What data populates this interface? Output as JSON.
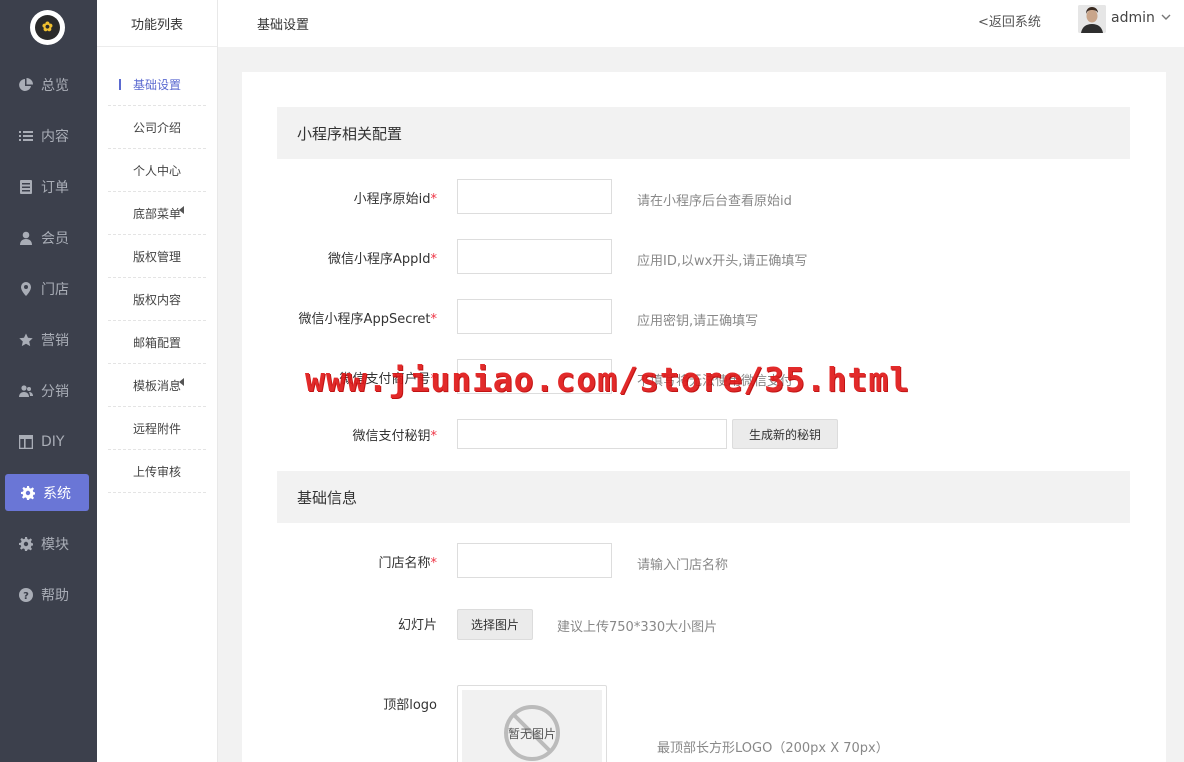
{
  "sidebar": {
    "items": [
      {
        "label": "总览",
        "icon": "pie-chart-icon"
      },
      {
        "label": "内容",
        "icon": "list-icon"
      },
      {
        "label": "订单",
        "icon": "document-icon"
      },
      {
        "label": "会员",
        "icon": "user-icon"
      },
      {
        "label": "门店",
        "icon": "location-pin-icon"
      },
      {
        "label": "营销",
        "icon": "star-icon"
      },
      {
        "label": "分销",
        "icon": "users-icon"
      },
      {
        "label": "DIY",
        "icon": "layout-icon"
      },
      {
        "label": "系统",
        "icon": "gear-icon"
      },
      {
        "label": "模块",
        "icon": "gear-icon"
      },
      {
        "label": "帮助",
        "icon": "help-icon"
      }
    ],
    "active": "系统"
  },
  "subpanel": {
    "title": "功能列表",
    "items": [
      {
        "label": "基础设置"
      },
      {
        "label": "公司介绍"
      },
      {
        "label": "个人中心"
      },
      {
        "label": "底部菜单"
      },
      {
        "label": "版权管理"
      },
      {
        "label": "版权内容"
      },
      {
        "label": "邮箱配置"
      },
      {
        "label": "模板消息"
      },
      {
        "label": "远程附件"
      },
      {
        "label": "上传审核"
      }
    ]
  },
  "topbar": {
    "breadcrumb": "基础设置",
    "back_label": "<返回系统",
    "username": "admin"
  },
  "form": {
    "section1_title": "小程序相关配置",
    "rows1": [
      {
        "label": "小程序原始id",
        "hint": "请在小程序后台查看原始id"
      },
      {
        "label": "微信小程序AppId",
        "hint": "应用ID,以wx开头,请正确填写"
      },
      {
        "label": "微信小程序AppSecret",
        "hint": "应用密钥,请正确填写"
      },
      {
        "label": "微信支付商户号",
        "hint": "不填写将无法使用微信支付"
      },
      {
        "label": "微信支付秘钥",
        "hint": ""
      }
    ],
    "generate_key_button": "生成新的秘钥",
    "section2_title": "基础信息",
    "store_name_label": "门店名称",
    "store_name_hint": "请输入门店名称",
    "slideshow_label": "幻灯片",
    "select_image_button": "选择图片",
    "slideshow_hint": "建议上传750*330大小图片",
    "top_logo_label": "顶部logo",
    "no_image_text": "暂无图片",
    "top_logo_hint": "最顶部长方形LOGO（200px X 70px）"
  },
  "watermark": "www.jiuniao.com/store/35.html",
  "colors": {
    "sidebar_bg": "#3c404c",
    "accent": "#6a76d6",
    "required": "#e34444",
    "watermark": "#e01818"
  }
}
